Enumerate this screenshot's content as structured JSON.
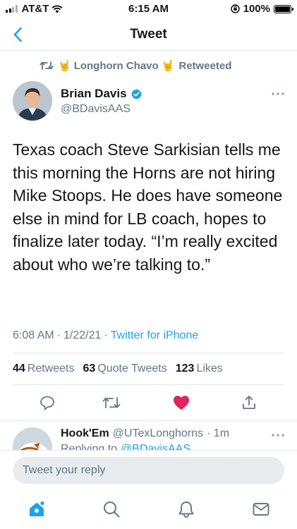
{
  "status_bar": {
    "carrier": "AT&T",
    "time": "6:15 AM",
    "battery": "100%"
  },
  "nav": {
    "title": "Tweet",
    "back_icon": "chevron-left-icon"
  },
  "retweet_context": {
    "name": "Longhorn Chavo",
    "emoji": "🤘",
    "action": "Retweeted"
  },
  "tweet": {
    "author_name": "Brian Davis",
    "author_handle": "@BDavisAAS",
    "verified": true,
    "text": "Texas coach Steve Sarkisian tells me this morning the Horns are not hiring Mike Stoops. He does have someone else in mind for LB coach, hopes to finalize later today. “I’m really excited about who we’re talking to.”",
    "time": "6:08 AM",
    "date": "1/22/21",
    "separator": "·",
    "source": "Twitter for iPhone",
    "stats": {
      "retweets_count": "44",
      "retweets_label": "Retweets",
      "quotes_count": "63",
      "quotes_label": "Quote Tweets",
      "likes_count": "123",
      "likes_label": "Likes"
    },
    "liked": true
  },
  "reply_preview": {
    "name": "Hook'Em",
    "handle": "@UTexLonghorns",
    "age": "· 1m",
    "replying_label": "Replying to",
    "replying_to": "@BDavisAAS"
  },
  "composer": {
    "placeholder": "Tweet your reply"
  },
  "tab_bar": {
    "items": [
      "home-icon",
      "search-icon",
      "notifications-icon",
      "messages-icon"
    ]
  },
  "colors": {
    "accent": "#1da1f2",
    "like": "#e0245e",
    "secondary_text": "#657786",
    "divider": "#e1e8ed"
  }
}
